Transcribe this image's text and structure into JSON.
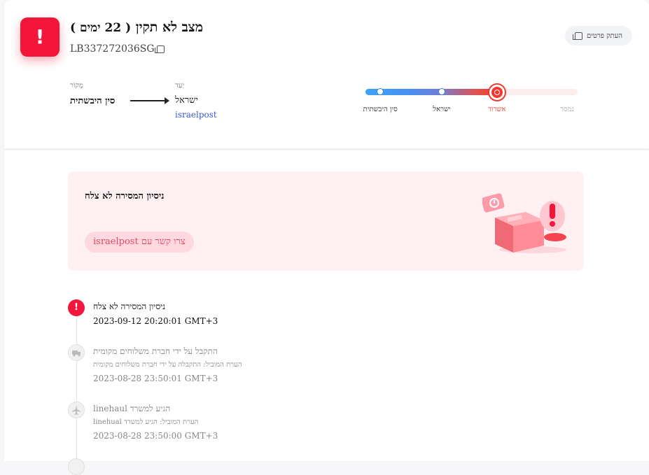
{
  "header": {
    "status_icon": "!",
    "status_title": "מצב לא תקין",
    "days_label": "(  22 ימים  )",
    "tracking_number": "LB337272036SG",
    "copy_details_label": "העתק פרטים"
  },
  "route": {
    "origin_label": "מָקוֹר",
    "origin_value": "סין היבשתית",
    "destination_label": "יַעַד",
    "destination_value": "ישראל",
    "carrier_link": "israelpost"
  },
  "progress": {
    "fill_fraction": 0.62,
    "stages": [
      {
        "label": "סין היבשתית",
        "position": 0.07,
        "state": "done"
      },
      {
        "label": "ישראל",
        "position": 0.36,
        "state": "done"
      },
      {
        "label": "אשדוד",
        "position": 0.62,
        "state": "current"
      },
      {
        "label": "נמסר",
        "position": 0.95,
        "state": "pending"
      }
    ]
  },
  "alert": {
    "title": "ניסיון המסירה לא צלח",
    "contact_button": "צרו קשר עם israelpost"
  },
  "timeline": [
    {
      "icon": "!",
      "title": "ניסיון המסירה לא צלח",
      "time": "2023-09-12 20:20:01 GMT+3",
      "note": ""
    },
    {
      "icon": "truck",
      "title": "התקבל על ידי חברת משלוחים מקומית",
      "note": "הערת המוביל: התקבלה על ידי חברת משלוחים מקומית",
      "time": "2023-08-28 23:50:01 GMT+3"
    },
    {
      "icon": "plane",
      "title": "הגיע למשרד linehaul",
      "note": "הערת המוביל: הגיע למשרד linehual",
      "time": "2023-08-28 23:50:00 GMT+3"
    }
  ],
  "colors": {
    "alert_red": "#f4163a",
    "link_blue": "#3a58c9",
    "progress_start": "#3ca4f8",
    "progress_end": "#f43b33",
    "alert_bg": "#fff1f3"
  }
}
